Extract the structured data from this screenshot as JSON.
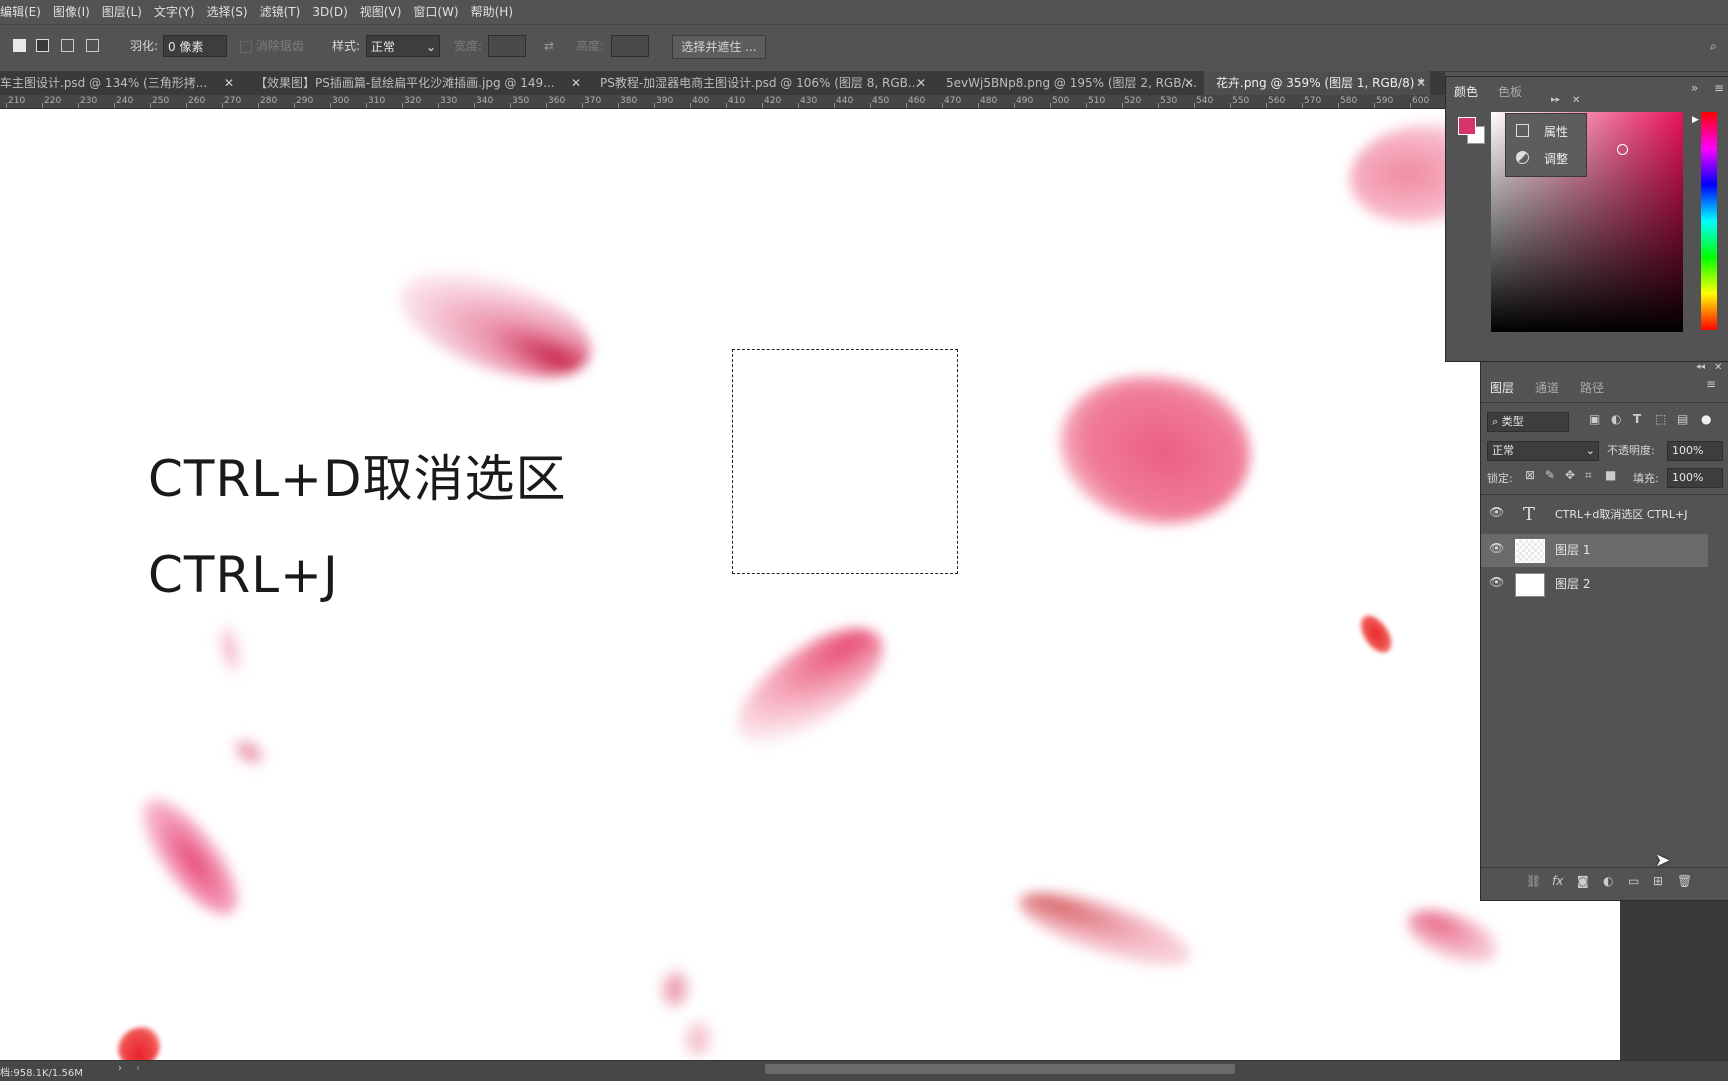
{
  "menu": [
    "编辑(E)",
    "图像(I)",
    "图层(L)",
    "文字(Y)",
    "选择(S)",
    "滤镜(T)",
    "3D(D)",
    "视图(V)",
    "窗口(W)",
    "帮助(H)"
  ],
  "options": {
    "feather_label": "羽化:",
    "feather_value": "0 像素",
    "antialias_label": "消除锯齿",
    "style_label": "样式:",
    "style_value": "正常",
    "width_label": "宽度:",
    "height_label": "高度:",
    "select_mask_button": "选择并遮住 ..."
  },
  "tabs": [
    "车主图设计.psd @ 134% (三角形拷...",
    "【效果图】PS插画篇-鼠绘扁平化沙滩插画.jpg @ 149...",
    "PS教程-加湿器电商主图设计.psd @ 106% (图层 8, RGB...",
    "5evWj5BNp8.png @ 195% (图层 2, RGB/...",
    "花卉.png @ 359% (图层 1, RGB/8) *"
  ],
  "ruler_labels": [
    "210",
    "220",
    "230",
    "240",
    "250",
    "260",
    "270",
    "280",
    "290",
    "300",
    "310",
    "320",
    "330",
    "340",
    "350",
    "360",
    "370",
    "380",
    "390",
    "400",
    "410",
    "420",
    "430",
    "440",
    "450",
    "460",
    "470",
    "480",
    "490",
    "500",
    "510",
    "520",
    "530",
    "540",
    "550",
    "560",
    "570",
    "580",
    "590",
    "600"
  ],
  "canvas": {
    "line1": "CTRL+D取消选区",
    "line2": "CTRL+J"
  },
  "color_panel": {
    "tab_color": "颜色",
    "tab_swatches": "色板",
    "popup_properties": "属性",
    "popup_adjustments": "调整",
    "foreground": "#d9336b",
    "background": "#ffffff"
  },
  "layers_panel": {
    "tabs": [
      "图层",
      "通道",
      "路径"
    ],
    "filter_label": "类型",
    "blend_mode": "正常",
    "opacity_label": "不透明度:",
    "opacity_value": "100%",
    "lock_label": "锁定:",
    "fill_label": "填充:",
    "fill_value": "100%",
    "layers": [
      {
        "name": "CTRL+d取消选区  CTRL+J",
        "type": "text"
      },
      {
        "name": "图层 1",
        "type": "pixel",
        "selected": true
      },
      {
        "name": "图层 2",
        "type": "pixel"
      }
    ]
  },
  "status": {
    "doc_size": "档:958.1K/1.56M"
  }
}
